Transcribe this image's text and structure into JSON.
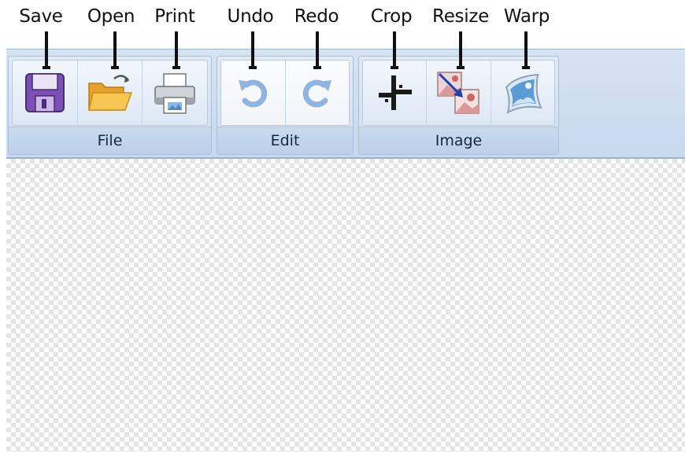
{
  "callouts": {
    "save": "Save",
    "open": "Open",
    "print": "Print",
    "undo": "Undo",
    "redo": "Redo",
    "crop": "Crop",
    "resize": "Resize",
    "warp": "Warp"
  },
  "ribbon": {
    "groups": [
      {
        "label": "File",
        "buttons": [
          {
            "name": "Save",
            "icon": "floppy-disk-icon",
            "enabled": true
          },
          {
            "name": "Open",
            "icon": "open-folder-icon",
            "enabled": true
          },
          {
            "name": "Print",
            "icon": "printer-icon",
            "enabled": true
          }
        ]
      },
      {
        "label": "Edit",
        "buttons": [
          {
            "name": "Undo",
            "icon": "undo-arrow-icon",
            "enabled": false
          },
          {
            "name": "Redo",
            "icon": "redo-arrow-icon",
            "enabled": false
          }
        ]
      },
      {
        "label": "Image",
        "buttons": [
          {
            "name": "Crop",
            "icon": "crop-icon",
            "enabled": true
          },
          {
            "name": "Resize",
            "icon": "resize-image-icon",
            "enabled": true
          },
          {
            "name": "Warp",
            "icon": "warp-image-icon",
            "enabled": true
          }
        ]
      }
    ]
  },
  "canvas": {
    "background": "transparent-checkerboard"
  },
  "colors": {
    "ribbon": "#cfdef0",
    "group_label": "#c3d5ec",
    "save_icon": "#7b4fb3",
    "folder_icon": "#f4b940",
    "disabled_arrow": "#8fb4df"
  }
}
